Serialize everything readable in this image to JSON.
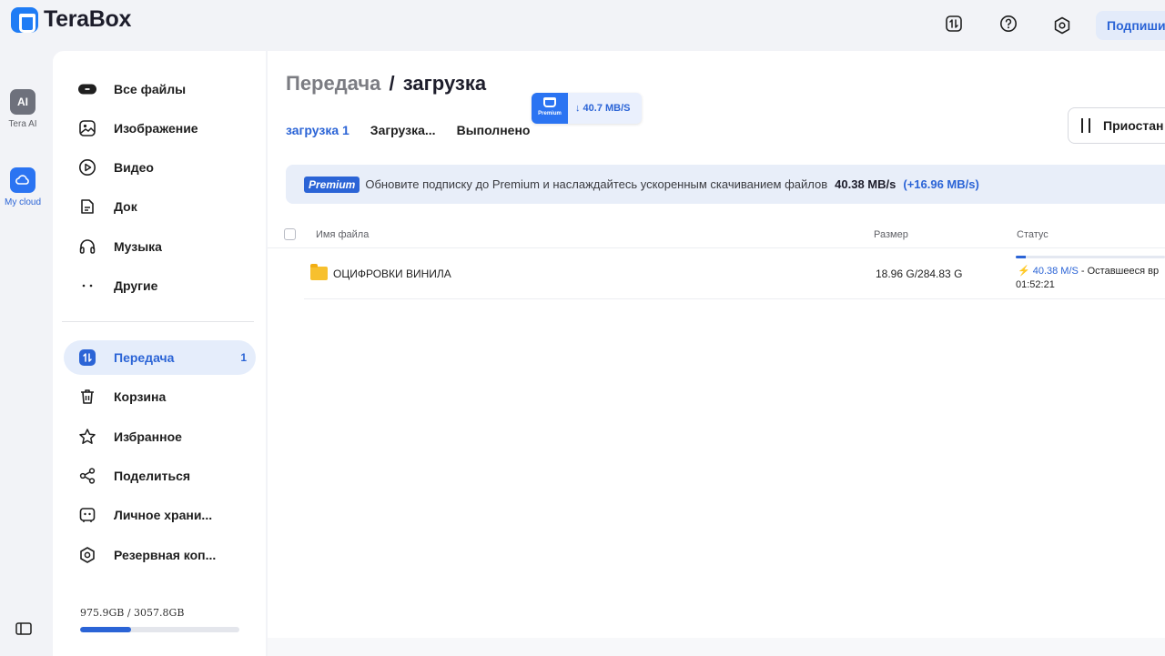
{
  "app": {
    "name": "TeraBox"
  },
  "header": {
    "subscribe_label": "Подпишит"
  },
  "rail": {
    "items": [
      {
        "badge": "AI",
        "label": "Tera AI"
      },
      {
        "label": "My cloud"
      }
    ]
  },
  "sidebar": {
    "items": [
      {
        "label": "Все файлы",
        "icon": "all-files-icon"
      },
      {
        "label": "Изображение",
        "icon": "image-icon"
      },
      {
        "label": "Видео",
        "icon": "video-icon"
      },
      {
        "label": "Док",
        "icon": "document-icon"
      },
      {
        "label": "Музыка",
        "icon": "headphones-icon"
      },
      {
        "label": "Другие",
        "icon": "more-dots-icon"
      },
      {
        "label": "Передача",
        "icon": "transfer-icon",
        "count": "1",
        "active": true
      },
      {
        "label": "Корзина",
        "icon": "trash-icon"
      },
      {
        "label": "Избранное",
        "icon": "star-icon"
      },
      {
        "label": "Поделиться",
        "icon": "share-icon"
      },
      {
        "label": "Личное храни...",
        "icon": "vault-icon"
      },
      {
        "label": "Резервная коп...",
        "icon": "backup-icon"
      }
    ],
    "storage": {
      "text": "975.9GB / 3057.8GB",
      "used_fraction": 0.319
    }
  },
  "main": {
    "breadcrumb": {
      "parent": "Передача",
      "separator": "/",
      "current": "загрузка"
    },
    "tabs": [
      {
        "label": "загрузка 1",
        "active": true
      },
      {
        "label": "Загрузка..."
      },
      {
        "label": "Выполнено"
      }
    ],
    "speed_chip": {
      "badge_label": "Premium",
      "speed": "↓ 40.7 MB/S"
    },
    "pause_label": "Приостан",
    "banner": {
      "tag": "Premium",
      "text": "Обновите подписку до Premium и наслаждайтесь ускоренным скачиванием файлов",
      "speed": "40.38 MB/s",
      "boost": "(+16.96 MB/s)"
    },
    "table": {
      "columns": [
        "Имя файла",
        "Размер",
        "Статус"
      ],
      "rows": [
        {
          "name": "ОЦИФРОВКИ ВИНИЛА",
          "size": "18.96 G/284.83 G",
          "progress": 0.067,
          "speed": "40.38 M/S",
          "remaining_label": " - Оставшееся вр",
          "remaining_time": "01:52:21"
        }
      ]
    }
  },
  "colors": {
    "accent": "#2b64d6",
    "brand": "#1f7cf5",
    "folder": "#f7c02e"
  }
}
